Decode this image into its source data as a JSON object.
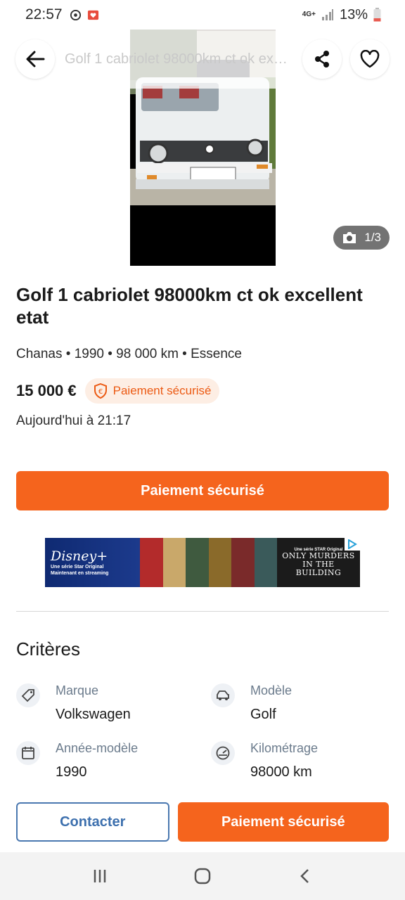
{
  "status_bar": {
    "time": "22:57",
    "network": "4G+",
    "battery": "13%"
  },
  "app_bar": {
    "title": "Golf 1 cabriolet 98000km ct ok excellent etat"
  },
  "gallery": {
    "counter": "1/3"
  },
  "listing": {
    "title": "Golf 1 cabriolet 98000km ct ok excellent etat",
    "subtitle": "Chanas • 1990 • 98 000 km • Essence",
    "price": "15 000 €",
    "badge": "Paiement sécurisé",
    "date": "Aujourd'hui à 21:17"
  },
  "primary_button": "Paiement sécurisé",
  "ad": {
    "brand": "Disney+",
    "tagline1": "Une série Star Original",
    "tagline2": "Maintenant en streaming",
    "right_top": "Une série STAR Original",
    "show_title1": "ONLY MURDERS",
    "show_title2": "IN THE BUILDING"
  },
  "criteria": {
    "title": "Critères",
    "items": [
      {
        "label": "Marque",
        "value": "Volkswagen"
      },
      {
        "label": "Modèle",
        "value": "Golf"
      },
      {
        "label": "Année-modèle",
        "value": "1990"
      },
      {
        "label": "Kilométrage",
        "value": "98000 km"
      }
    ]
  },
  "bottom_bar": {
    "contact": "Contacter",
    "pay": "Paiement sécurisé"
  },
  "colors": {
    "accent": "#f5641d",
    "link_blue": "#3d70ae"
  }
}
